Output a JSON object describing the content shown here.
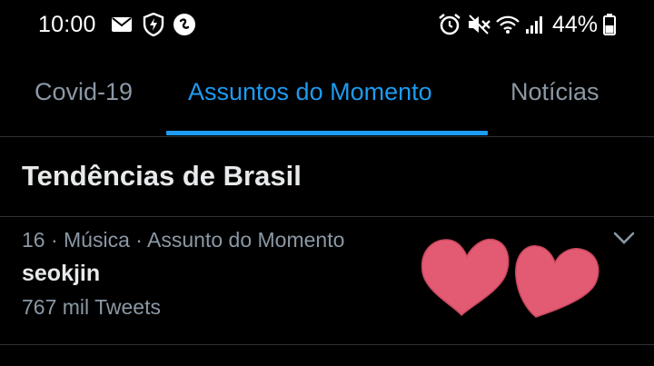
{
  "status_bar": {
    "time": "10:00",
    "battery": "44%",
    "left_icons": [
      "mail-icon",
      "shield-bolt-icon",
      "shazam-icon"
    ],
    "right_icons": [
      "alarm-icon",
      "mute-icon",
      "wifi-icon",
      "signal-icon",
      "battery-icon"
    ]
  },
  "tabs": [
    {
      "label": "Covid-19",
      "active": false
    },
    {
      "label": "Assuntos do Momento",
      "active": true
    },
    {
      "label": "Notícias",
      "active": false
    }
  ],
  "section": {
    "title": "Tendências de Brasil"
  },
  "trend": {
    "meta": "16 · Música · Assunto do Momento",
    "name": "seokjin",
    "count": "767 mil Tweets"
  },
  "colors": {
    "accent": "#1d9bf0",
    "muted": "#8b98a5",
    "heart": "#e35b72"
  },
  "sticker": "two-hearts-sticker"
}
